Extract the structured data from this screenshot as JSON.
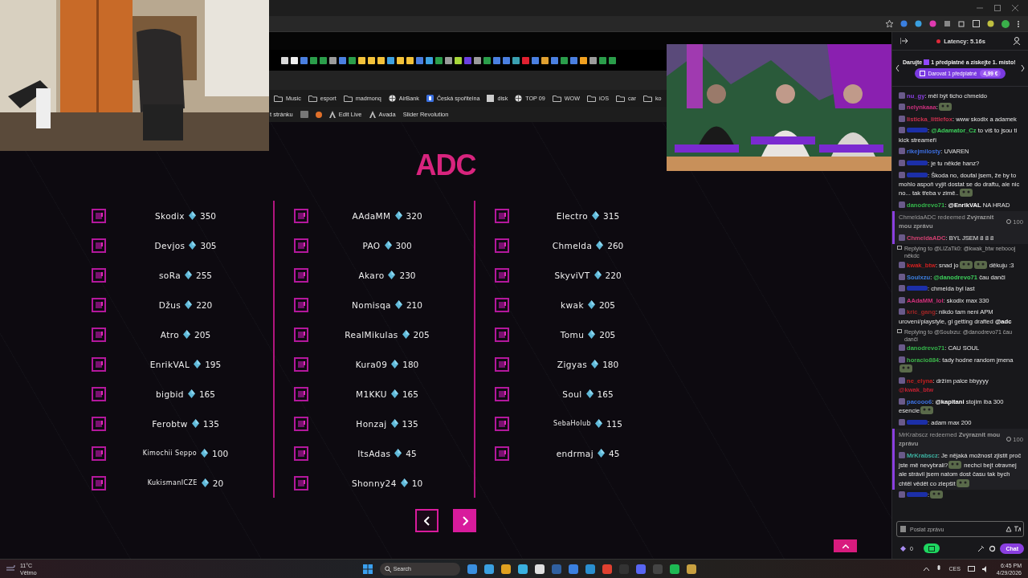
{
  "browser": {
    "bookmarks": [
      {
        "label": "Music",
        "kind": "folder"
      },
      {
        "label": "esport",
        "kind": "folder"
      },
      {
        "label": "madmonq",
        "kind": "folder"
      },
      {
        "label": "AirBank",
        "kind": "globe"
      },
      {
        "label": "Česká spořitelna",
        "kind": "bank"
      },
      {
        "label": "disk",
        "kind": "disk"
      },
      {
        "label": "TOP 09",
        "kind": "globe"
      },
      {
        "label": "WOW",
        "kind": "folder"
      },
      {
        "label": "iOS",
        "kind": "folder"
      },
      {
        "label": "car",
        "kind": "folder"
      },
      {
        "label": "ko",
        "kind": "folder"
      }
    ],
    "admin_bar": [
      {
        "label": "t stránku",
        "kind": "cut"
      },
      {
        "label": "Edit Live",
        "kind": "avada"
      },
      {
        "label": "Avada",
        "kind": "avada"
      },
      {
        "label": "Slider Revolution",
        "kind": "plain"
      }
    ]
  },
  "page": {
    "title": "ADC",
    "columns": [
      {
        "players": [
          {
            "name": "Skodix",
            "score": "350",
            "kind": "normal"
          },
          {
            "name": "Devjos",
            "score": "305",
            "kind": "normal"
          },
          {
            "name": "soRa",
            "score": "255",
            "kind": "normal"
          },
          {
            "name": "Džus",
            "score": "220",
            "kind": "normal"
          },
          {
            "name": "Atro",
            "score": "205",
            "kind": "normal"
          },
          {
            "name": "EnrikVAL",
            "score": "195",
            "kind": "normal"
          },
          {
            "name": "bigbid",
            "score": "165",
            "kind": "normal"
          },
          {
            "name": "Ferobtw",
            "score": "135",
            "kind": "normal"
          },
          {
            "name": "Kimochii Seppo",
            "score": "100",
            "kind": "small"
          },
          {
            "name": "KukismanICZE",
            "score": "20",
            "kind": "small"
          }
        ]
      },
      {
        "players": [
          {
            "name": "AAdaMM",
            "score": "320",
            "kind": "normal"
          },
          {
            "name": "PAO",
            "score": "300",
            "kind": "normal"
          },
          {
            "name": "Akaro",
            "score": "230",
            "kind": "normal"
          },
          {
            "name": "Nomisqa",
            "score": "210",
            "kind": "normal"
          },
          {
            "name": "RealMikulas",
            "score": "205",
            "kind": "normal"
          },
          {
            "name": "Kura09",
            "score": "180",
            "kind": "normal"
          },
          {
            "name": "M1KKU",
            "score": "165",
            "kind": "normal"
          },
          {
            "name": "Honzaj",
            "score": "135",
            "kind": "normal"
          },
          {
            "name": "ItsAdas",
            "score": "45",
            "kind": "normal"
          },
          {
            "name": "Shonny24",
            "score": "10",
            "kind": "normal"
          }
        ]
      },
      {
        "players": [
          {
            "name": "Electro",
            "score": "315",
            "kind": "normal"
          },
          {
            "name": "Chmelda",
            "score": "260",
            "kind": "normal"
          },
          {
            "name": "SkyviVT",
            "score": "220",
            "kind": "normal"
          },
          {
            "name": "kwak",
            "score": "205",
            "kind": "normal"
          },
          {
            "name": "Tomu",
            "score": "205",
            "kind": "normal"
          },
          {
            "name": "Zigyas",
            "score": "180",
            "kind": "normal"
          },
          {
            "name": "Soul",
            "score": "165",
            "kind": "normal"
          },
          {
            "name": "SebaHolub",
            "score": "115",
            "kind": "small"
          },
          {
            "name": "endrmaj",
            "score": "45",
            "kind": "normal"
          }
        ]
      }
    ],
    "pager": [
      {
        "kind": "prev"
      },
      {
        "kind": "next"
      }
    ]
  },
  "chat": {
    "latency": "Latency: 5.16s",
    "banner": {
      "before": "Darujte",
      "after": "1 předplatné a získejte 1. místo!",
      "button": "Darovat 1 předplatné",
      "price": "4,99 €"
    },
    "messages": [
      {
        "kind": "message",
        "name": "nu_gy",
        "color": "#8a3fe0",
        "highlight": false,
        "segments": [
          {
            "kind": "text",
            "text": ": měl být ticho chmeldo"
          }
        ]
      },
      {
        "kind": "message",
        "name": "nelynkaaa",
        "color": "#c8307c",
        "highlight": false,
        "segments": [
          {
            "kind": "text",
            "text": ":"
          },
          {
            "kind": "emote"
          }
        ]
      },
      {
        "kind": "message",
        "name": "listicka_littlefox",
        "color": "#c8304e",
        "highlight": false,
        "segments": [
          {
            "kind": "text",
            "text": ": www skodix a adamek"
          }
        ]
      },
      {
        "kind": "message",
        "color": "#1c2fa8",
        "highlight": false,
        "segments": [
          {
            "kind": "text",
            "text": ": "
          },
          {
            "kind": "mention",
            "text": "@Adamator_Cz",
            "color": "#3ccf5a"
          },
          {
            "kind": "text",
            "text": " to víš to jsou ti kick streameři"
          }
        ]
      },
      {
        "kind": "message",
        "name": "rikejmilosty",
        "color": "#3d6fe0",
        "highlight": false,
        "segments": [
          {
            "kind": "text",
            "text": ": UVAREN"
          }
        ]
      },
      {
        "kind": "message",
        "color": "#1c2fa8",
        "highlight": false,
        "segments": [
          {
            "kind": "text",
            "text": ": je tu někde hanz?"
          }
        ]
      },
      {
        "kind": "message",
        "color": "#1c2fa8",
        "highlight": false,
        "segments": [
          {
            "kind": "text",
            "text": ": Škoda no, doufal jsem, že by to mohlo aspoň vyjít dostat se do draftu, ale nic no... tak třeba v zimě.."
          },
          {
            "kind": "emote"
          }
        ]
      },
      {
        "kind": "message",
        "name": "danodrevo71",
        "color": "#34b34a",
        "highlight": false,
        "segments": [
          {
            "kind": "text",
            "text": ": "
          },
          {
            "kind": "mention",
            "text": "@EnrikVAL",
            "color": "#ffffff"
          },
          {
            "kind": "text",
            "text": " NA HRAD"
          }
        ]
      },
      {
        "kind": "redeem",
        "text": "ChmeldaADC redeemed **Zvýraznit mou zprávu**",
        "cost": "100"
      },
      {
        "kind": "message",
        "name": "ChmeldaADC",
        "color": "#d04070",
        "highlight": true,
        "segments": [
          {
            "kind": "text",
            "text": ": BYL JSEM 8 8 8"
          }
        ]
      },
      {
        "kind": "reply",
        "text": "Replying to @LIZaTk0: @kwak_btw neboooj někdc"
      },
      {
        "kind": "message",
        "name": "kwak_btw",
        "color": "#d02020",
        "highlight": false,
        "segments": [
          {
            "kind": "text",
            "text": ": snad jo"
          },
          {
            "kind": "emote"
          },
          {
            "kind": "emote"
          },
          {
            "kind": "text",
            "text": " děkuju :3"
          }
        ]
      },
      {
        "kind": "message",
        "name": "Soulxzu",
        "color": "#3c7fe0",
        "highlight": false,
        "segments": [
          {
            "kind": "text",
            "text": ": "
          },
          {
            "kind": "mention",
            "text": "@danodrevo71",
            "color": "#3ccf5a"
          },
          {
            "kind": "text",
            "text": " čau danči"
          }
        ]
      },
      {
        "kind": "message",
        "color": "#1c2fa8",
        "highlight": false,
        "segments": [
          {
            "kind": "text",
            "text": ": chmelda byl last"
          }
        ]
      },
      {
        "kind": "message",
        "name": "AAdaMM_lol",
        "color": "#d0307a",
        "highlight": false,
        "segments": [
          {
            "kind": "text",
            "text": ": skodix max 330"
          }
        ]
      },
      {
        "kind": "message",
        "name": "kric_gang",
        "color": "#a02626",
        "highlight": false,
        "segments": [
          {
            "kind": "text",
            "text": ": nikdo tam neni APM urovení/playstyle, gl getting drafted "
          },
          {
            "kind": "mention",
            "text": "@adc",
            "color": "#ffffff"
          }
        ]
      },
      {
        "kind": "reply",
        "text": "Replying to @Soulxzu: @danodrevo71 čau danči"
      },
      {
        "kind": "message",
        "name": "danodrevo71",
        "color": "#34b34a",
        "highlight": false,
        "segments": [
          {
            "kind": "text",
            "text": ": CAU SOUL"
          }
        ]
      },
      {
        "kind": "message",
        "name": "horacio884",
        "color": "#3cb34a",
        "highlight": false,
        "segments": [
          {
            "kind": "text",
            "text": ": tady hodne random jmena"
          },
          {
            "kind": "emote"
          }
        ]
      },
      {
        "kind": "message",
        "name": "ne_elyna",
        "color": "#c02020",
        "highlight": false,
        "segments": [
          {
            "kind": "text",
            "text": ": držím palce bbyyyy "
          },
          {
            "kind": "mention",
            "text": "@kwak_btw",
            "color": "#c02030"
          }
        ]
      },
      {
        "kind": "message",
        "name": "pacooo6",
        "color": "#3c70e0",
        "highlight": false,
        "segments": [
          {
            "kind": "text",
            "text": ": "
          },
          {
            "kind": "mention",
            "text": "@kapitani",
            "color": "#ffffff"
          },
          {
            "kind": "text",
            "text": " stojim iba 300 esencie"
          },
          {
            "kind": "emote"
          }
        ]
      },
      {
        "kind": "message",
        "color": "#1c2fa8",
        "highlight": false,
        "segments": [
          {
            "kind": "text",
            "text": ": adam max 200"
          }
        ]
      },
      {
        "kind": "redeem",
        "text": "MrKrabscz redeemed **Zvýraznit mou zprávu**",
        "cost": "100"
      },
      {
        "kind": "message",
        "name": "MrKrabscz",
        "color": "#3cb0a0",
        "highlight": true,
        "segments": [
          {
            "kind": "text",
            "text": ": Je nějaká možnost zjistit proč jste mě nevybrali?"
          },
          {
            "kind": "emote"
          },
          {
            "kind": "text",
            "text": " nechci bejt otravnej ale strávil jsem natom dost času tak bych chtěl vědět co zlepšit"
          },
          {
            "kind": "emote"
          }
        ]
      },
      {
        "kind": "message",
        "color": "#1c2fa8",
        "highlight": false,
        "segments": [
          {
            "kind": "text",
            "text": ":"
          },
          {
            "kind": "emote"
          }
        ]
      }
    ],
    "input": {
      "placeholder": "Poslat zprávu"
    },
    "points": "0",
    "chat_button": "Chat"
  },
  "taskbar": {
    "temperature": "11°C",
    "weather": "Větrno",
    "search": {
      "placeholder": "Search"
    },
    "language": "CES",
    "time": "6:45 PM",
    "date": "4/29/2026"
  }
}
